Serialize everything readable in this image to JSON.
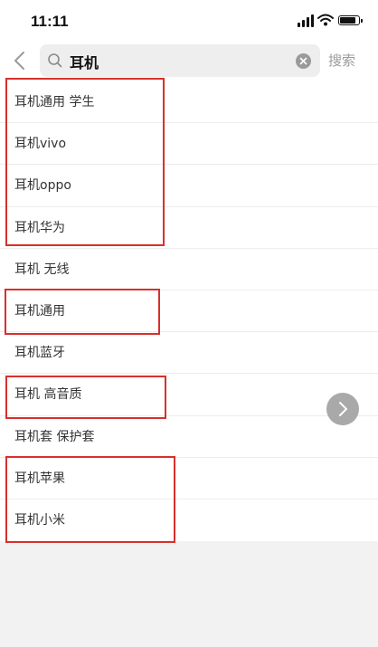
{
  "status_bar": {
    "time": "11:11"
  },
  "header": {
    "search_query": "耳机",
    "search_button_label": "搜索"
  },
  "suggestions": [
    {
      "label": "耳机通用 学生",
      "highlighted": true
    },
    {
      "label": "耳机vivo",
      "highlighted": true
    },
    {
      "label": "耳机oppo",
      "highlighted": true
    },
    {
      "label": "耳机华为",
      "highlighted": true
    },
    {
      "label": "耳机 无线",
      "highlighted": false
    },
    {
      "label": "耳机通用",
      "highlighted": true
    },
    {
      "label": "耳机蓝牙",
      "highlighted": false
    },
    {
      "label": "耳机 高音质",
      "highlighted": true
    },
    {
      "label": "耳机套 保护套",
      "highlighted": false
    },
    {
      "label": "耳机苹果",
      "highlighted": true
    },
    {
      "label": "耳机小米",
      "highlighted": true
    }
  ],
  "colors": {
    "highlight_border": "#d8302c",
    "background": "#f2f2f2"
  },
  "icons": {
    "back": "chevron-left-icon",
    "search": "magnifier-icon",
    "clear": "close-circle-icon",
    "floating": "chevron-right-icon"
  }
}
